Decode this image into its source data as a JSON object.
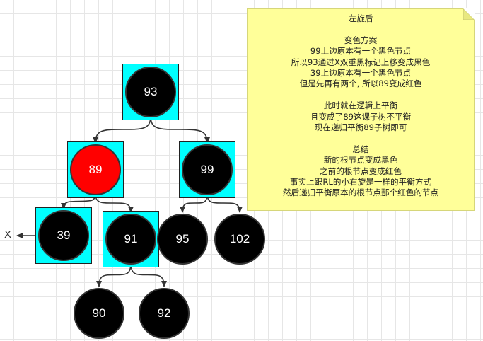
{
  "note": {
    "lines": [
      "左旋后",
      "",
      "变色方案",
      "99上边原本有一个黑色节点",
      "所以93通过X双重黑标记上移变成黑色",
      "39上边原本有一个黑色节点",
      "但是先再有两个, 所以89变成红色",
      "",
      "此时就在逻辑上平衡",
      "且变成了89这课子树不平衡",
      "现在递归平衡89子树即可",
      "",
      "总结",
      "新的根节点变成黑色",
      "之前的根节点变成红色",
      "事实上跟RL的小右旋是一样的平衡方式",
      "然后递归平衡原本的根节点那个红色的节点"
    ]
  },
  "tree": {
    "nodes": [
      {
        "id": "n93",
        "label": "93",
        "color": "#000000",
        "highlighted": true
      },
      {
        "id": "n89",
        "label": "89",
        "color": "#ff0000",
        "highlighted": true
      },
      {
        "id": "n99",
        "label": "99",
        "color": "#000000",
        "highlighted": true
      },
      {
        "id": "n39",
        "label": "39",
        "color": "#000000",
        "highlighted": true
      },
      {
        "id": "n91",
        "label": "91",
        "color": "#000000",
        "highlighted": true
      },
      {
        "id": "n95",
        "label": "95",
        "color": "#000000",
        "highlighted": false
      },
      {
        "id": "n102",
        "label": "102",
        "color": "#000000",
        "highlighted": false
      },
      {
        "id": "n90",
        "label": "90",
        "color": "#000000",
        "highlighted": false
      },
      {
        "id": "n92",
        "label": "92",
        "color": "#000000",
        "highlighted": false
      }
    ],
    "edges": [
      {
        "from": "n93",
        "to": "n89"
      },
      {
        "from": "n93",
        "to": "n99"
      },
      {
        "from": "n89",
        "to": "n39"
      },
      {
        "from": "n89",
        "to": "n91"
      },
      {
        "from": "n99",
        "to": "n95"
      },
      {
        "from": "n99",
        "to": "n102"
      },
      {
        "from": "n91",
        "to": "n90"
      },
      {
        "from": "n91",
        "to": "n92"
      }
    ],
    "highlight_color": "#00ffff",
    "x_marker": "X"
  }
}
